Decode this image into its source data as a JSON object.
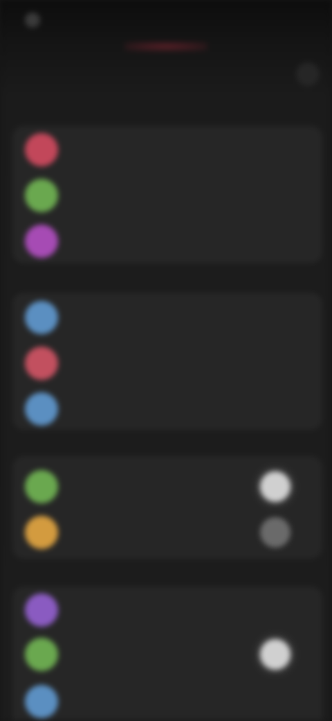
{
  "status_bar": {
    "time": ""
  },
  "header": {
    "title": ""
  },
  "groups": [
    {
      "rows": [
        {
          "label": "",
          "icon": "circle-icon",
          "color": "#c2475a"
        },
        {
          "label": "",
          "icon": "circle-icon",
          "color": "#6aa84f"
        },
        {
          "label": "",
          "icon": "circle-icon",
          "color": "#a64bb4"
        }
      ]
    },
    {
      "rows": [
        {
          "label": "",
          "icon": "circle-icon",
          "color": "#5b8fc1"
        },
        {
          "label": "",
          "icon": "circle-icon",
          "color": "#c2505f"
        },
        {
          "label": "",
          "icon": "circle-icon",
          "color": "#5b8fc1"
        }
      ]
    },
    {
      "rows": [
        {
          "label": "",
          "icon": "circle-icon",
          "color": "#6aa84f",
          "toggle": true,
          "toggle_on": true
        },
        {
          "label": "",
          "icon": "circle-icon",
          "color": "#d39b3f",
          "toggle": true,
          "toggle_on": false
        }
      ]
    },
    {
      "rows": [
        {
          "label": "",
          "icon": "circle-icon",
          "color": "#8a5bc1"
        },
        {
          "label": "",
          "icon": "circle-icon",
          "color": "#6aa84f",
          "toggle": true,
          "toggle_on": true
        },
        {
          "label": "",
          "icon": "circle-icon",
          "color": "#5b8fc1"
        }
      ]
    }
  ]
}
